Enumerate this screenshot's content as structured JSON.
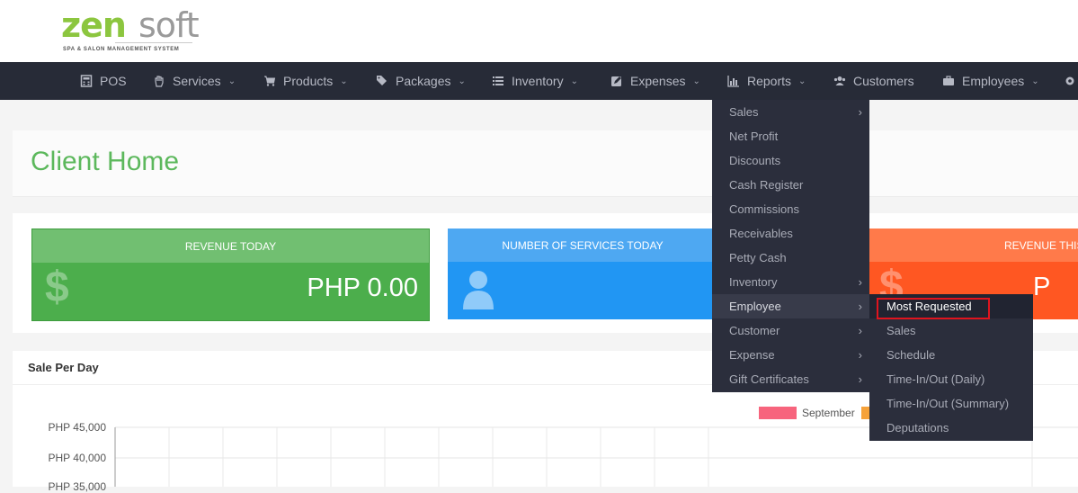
{
  "logo": {
    "brand_a": "zen",
    "brand_b": "soft",
    "tagline": "SPA & SALON MANAGEMENT SYSTEM"
  },
  "nav": {
    "items": [
      {
        "label": "POS",
        "icon": "calculator-icon",
        "dropdown": false
      },
      {
        "label": "Services",
        "icon": "hand-icon",
        "dropdown": true
      },
      {
        "label": "Products",
        "icon": "cart-icon",
        "dropdown": true
      },
      {
        "label": "Packages",
        "icon": "tags-icon",
        "dropdown": true
      },
      {
        "label": "Inventory",
        "icon": "list-icon",
        "dropdown": true
      },
      {
        "label": "Expenses",
        "icon": "edit-icon",
        "dropdown": true
      },
      {
        "label": "Reports",
        "icon": "bar-chart-icon",
        "dropdown": true
      },
      {
        "label": "Customers",
        "icon": "users-icon",
        "dropdown": false
      },
      {
        "label": "Employees",
        "icon": "briefcase-icon",
        "dropdown": true
      }
    ],
    "chevron": "⌄"
  },
  "page": {
    "title": "Client Home"
  },
  "cards": [
    {
      "title": "REVENUE TODAY",
      "value": "PHP 0.00",
      "color": "#4cae4c"
    },
    {
      "title": "NUMBER OF SERVICES TODAY",
      "value": "",
      "color": "#2196f3"
    },
    {
      "title": "REVENUE THIS",
      "value": "P",
      "color": "#ff5722"
    }
  ],
  "card_icons": {
    "dollar": "$"
  },
  "chart_panel": {
    "title": "Sale Per Day",
    "legend": [
      {
        "name": "September",
        "color": "#f7647d"
      },
      {
        "name": "",
        "color": "#f6a23a"
      }
    ],
    "y_ticks": [
      "PHP 45,000",
      "PHP 40,000",
      "PHP 35,000"
    ]
  },
  "reports_menu": {
    "items": [
      {
        "label": "Sales",
        "submenu": true
      },
      {
        "label": "Net Profit",
        "submenu": false
      },
      {
        "label": "Discounts",
        "submenu": false
      },
      {
        "label": "Cash Register",
        "submenu": false
      },
      {
        "label": "Commissions",
        "submenu": false
      },
      {
        "label": "Receivables",
        "submenu": false
      },
      {
        "label": "Petty Cash",
        "submenu": false
      },
      {
        "label": "Inventory",
        "submenu": true
      },
      {
        "label": "Employee",
        "submenu": true
      },
      {
        "label": "Customer",
        "submenu": true
      },
      {
        "label": "Expense",
        "submenu": true
      },
      {
        "label": "Gift Certificates",
        "submenu": true
      }
    ],
    "arrow": "›",
    "active": "Employee"
  },
  "employee_submenu": {
    "items": [
      {
        "label": "Most Requested"
      },
      {
        "label": "Sales"
      },
      {
        "label": "Schedule"
      },
      {
        "label": "Time-In/Out (Daily)"
      },
      {
        "label": "Time-In/Out (Summary)"
      },
      {
        "label": "Deputations"
      }
    ],
    "highlighted": "Most Requested"
  }
}
